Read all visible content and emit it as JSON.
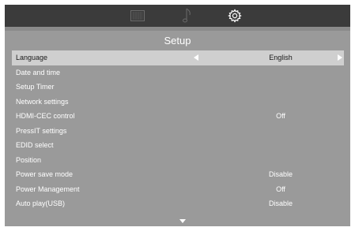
{
  "tabs": [
    {
      "icon": "picture-icon"
    },
    {
      "icon": "music-note-icon"
    },
    {
      "icon": "gear-icon"
    }
  ],
  "title": "Setup",
  "menu": [
    {
      "label": "Language",
      "value": "English",
      "selected": true
    },
    {
      "label": "Date and time",
      "value": ""
    },
    {
      "label": "Setup Timer",
      "value": ""
    },
    {
      "label": "Network settings",
      "value": ""
    },
    {
      "label": "HDMI-CEC control",
      "value": "Off"
    },
    {
      "label": "PressIT settings",
      "value": ""
    },
    {
      "label": "EDID select",
      "value": ""
    },
    {
      "label": "Position",
      "value": ""
    },
    {
      "label": "Power save mode",
      "value": "Disable"
    },
    {
      "label": "Power Management",
      "value": "Off"
    },
    {
      "label": "Auto play(USB)",
      "value": "Disable"
    }
  ],
  "colors": {
    "topbar": "#3b3b3b",
    "panel": "#9a9a9a",
    "selected_row": "#cfcfcf",
    "text": "#ffffff"
  }
}
